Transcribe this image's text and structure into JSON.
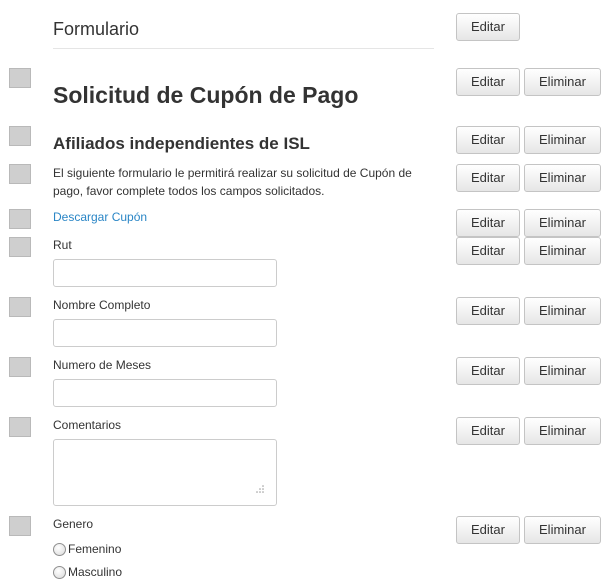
{
  "form": {
    "title": "Formulario",
    "edit_label": "Editar",
    "delete_label": "Eliminar"
  },
  "heading": "Solicitud de Cupón de Pago",
  "subheading": "Afiliados independientes de ISL",
  "description": "El siguiente formulario le permitirá realizar su solicitud de Cupón de pago, favor complete todos los campos solicitados.",
  "download_link": "Descargar Cupón",
  "fields": {
    "rut": {
      "label": "Rut",
      "value": "",
      "placeholder": ""
    },
    "nombre": {
      "label": "Nombre Completo",
      "value": "",
      "placeholder": ""
    },
    "meses": {
      "label": "Numero de Meses",
      "value": "",
      "placeholder": ""
    },
    "comentarios": {
      "label": "Comentarios",
      "value": "",
      "placeholder": ""
    }
  },
  "genero": {
    "label": "Genero",
    "options": [
      "Femenino",
      "Masculino"
    ]
  },
  "icons": {
    "drag_handle": "drag-handle-icon",
    "textarea_resize": "resize-grip-icon",
    "radio": "radio-icon"
  },
  "colors": {
    "link": "#2a86c6",
    "handle": "#cfcfcf",
    "text": "#333333"
  }
}
